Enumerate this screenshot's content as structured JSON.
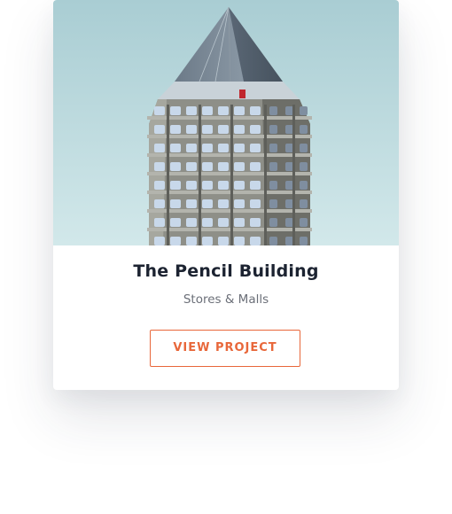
{
  "card": {
    "title": "The Pencil Building",
    "category": "Stores & Malls",
    "button_label": "VIEW PROJECT"
  },
  "colors": {
    "accent": "#e8673a",
    "title": "#1c2331",
    "muted": "#6b6f78",
    "sky_top": "#a9cdd3",
    "sky_bottom": "#cfe6e9"
  }
}
